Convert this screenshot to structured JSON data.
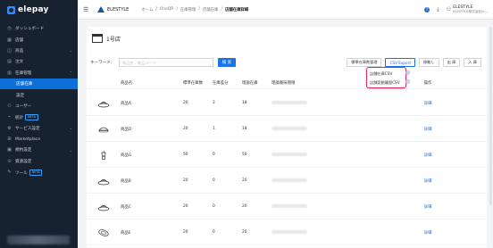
{
  "app": {
    "logo_text": "elepay"
  },
  "sidebar": {
    "items": [
      {
        "icon": "dashboard-icon",
        "glyph": "◷",
        "label": "ダッシュボード",
        "chev": ""
      },
      {
        "icon": "store-icon",
        "glyph": "▦",
        "label": "店舗",
        "chev": ""
      },
      {
        "icon": "product-icon",
        "glyph": "◫",
        "label": "商品",
        "chev": "⌄"
      },
      {
        "icon": "order-icon",
        "glyph": "▤",
        "label": "注文",
        "chev": ""
      },
      {
        "icon": "inventory-icon",
        "glyph": "▥",
        "label": "在庫管理",
        "chev": "⌃"
      },
      {
        "icon": "",
        "glyph": "",
        "label": "店舗在庫",
        "chev": "",
        "active": true,
        "sub": true
      },
      {
        "icon": "",
        "glyph": "",
        "label": "設定",
        "chev": "",
        "sub": true
      },
      {
        "icon": "user-icon",
        "glyph": "⚇",
        "label": "ユーザー",
        "chev": ""
      },
      {
        "icon": "stats-icon",
        "glyph": "⌁",
        "label": "統計",
        "chev": "",
        "badge": "BETA"
      },
      {
        "icon": "service-icon",
        "glyph": "⚙",
        "label": "サービス設定",
        "chev": "⌄"
      },
      {
        "icon": "marketplace-icon",
        "glyph": "⊞",
        "label": "Marketplace",
        "chev": ""
      },
      {
        "icon": "account-icon",
        "glyph": "▣",
        "label": "規約設定",
        "chev": "⌄"
      },
      {
        "icon": "asset-icon",
        "glyph": "⊙",
        "label": "資源設定",
        "chev": ""
      },
      {
        "icon": "tool-icon",
        "glyph": "✎",
        "label": "ツール",
        "chev": "",
        "badge": "BETA"
      }
    ]
  },
  "header": {
    "brand": "ELESTYLE",
    "breadcrumbs": [
      "ホーム",
      "OneQR",
      "在庫管理",
      "店舗在庫",
      "店舗在庫詳細"
    ],
    "user_name": "ELESTYLE",
    "user_company": "ELESTYLE株式会社(ir..."
  },
  "page": {
    "store_name": "1号店",
    "keyword_label": "キーワード:",
    "keyword_placeholder": "商品名、商品コード",
    "search_button": "検 索",
    "buttons": {
      "standard": "標準在庫数管理",
      "csv_export": "CSV Export",
      "transfer": "移動し",
      "out": "出 庫",
      "in": "入 庫"
    },
    "csv_menu": [
      "店舗在庫CSV",
      "店舗変動履歴CSV"
    ]
  },
  "table": {
    "headers": [
      "商品名",
      "標準在庫数",
      "在庫差分",
      "理論在庫",
      "理論賞味期限",
      "操作"
    ],
    "rows": [
      {
        "icon": "food-plate-icon",
        "name": "商品A",
        "std": "20",
        "diff": "2",
        "theory": "18",
        "action": "詳細"
      },
      {
        "icon": "burger-icon",
        "name": "商品D",
        "std": "20",
        "diff": "1",
        "theory": "18",
        "action": "詳細"
      },
      {
        "icon": "drink-cup-icon",
        "name": "商品G",
        "std": "50",
        "diff": "0",
        "theory": "50",
        "action": "詳細"
      },
      {
        "icon": "food-plate-icon",
        "name": "商品B",
        "std": "20",
        "diff": "0",
        "theory": "20",
        "action": "詳細"
      },
      {
        "icon": "food-plate-icon",
        "name": "商品C",
        "std": "20",
        "diff": "0",
        "theory": "20",
        "action": "詳細"
      },
      {
        "icon": "sushi-icon",
        "name": "商品E",
        "std": "20",
        "diff": "0",
        "theory": "20",
        "action": "詳細"
      }
    ]
  },
  "colors": {
    "sidebar_bg": "#172230",
    "active": "#0e6fd8",
    "primary": "#1a73e8",
    "highlight": "#e0245e"
  }
}
